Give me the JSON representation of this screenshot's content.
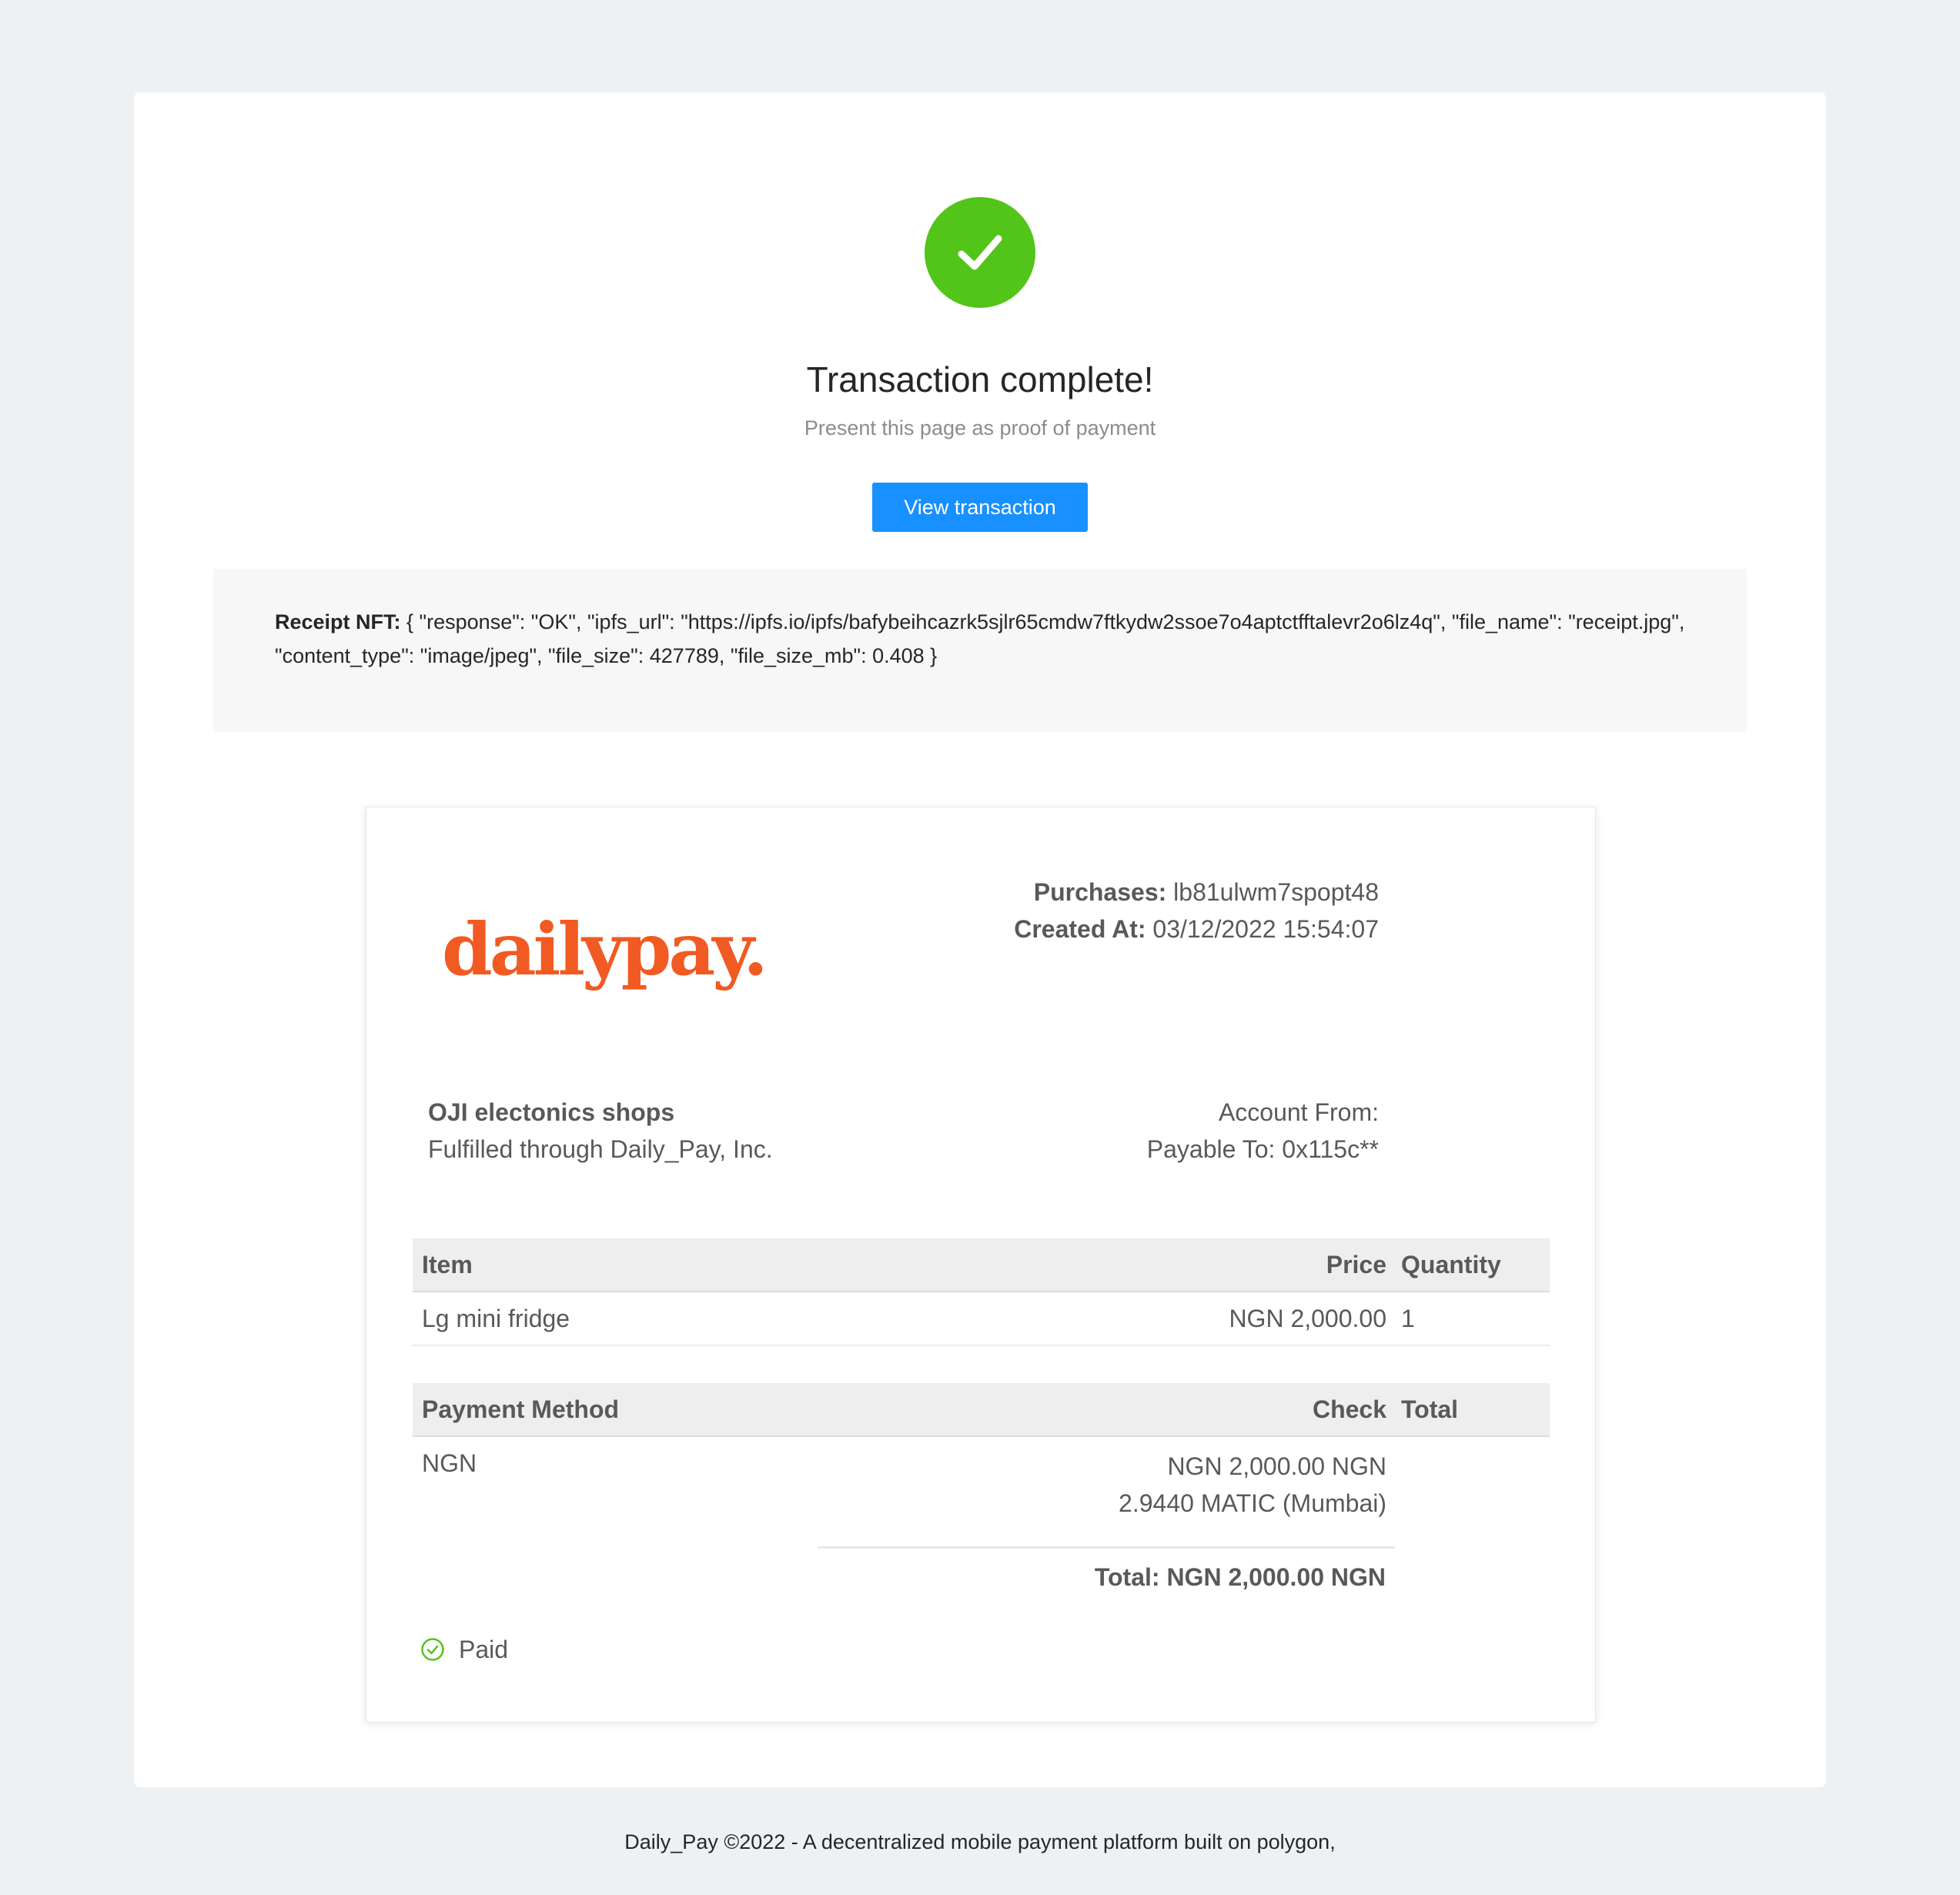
{
  "header": {
    "title": "Transaction complete!",
    "subtitle": "Present this page as proof of payment",
    "view_button_label": "View transaction",
    "icon": "check-circle-icon",
    "success_color": "#52c41a",
    "button_color": "#1890ff"
  },
  "nft": {
    "label": "Receipt NFT:",
    "value": " { \"response\": \"OK\", \"ipfs_url\": \"https://ipfs.io/ipfs/bafybeihcazrk5sjlr65cmdw7ftkydw2ssoe7o4aptctfftalevr2o6lz4q\", \"file_name\": \"receipt.jpg\", \"content_type\": \"image/jpeg\", \"file_size\": 427789, \"file_size_mb\": 0.408 }"
  },
  "receipt": {
    "logo_text": "dailypay.",
    "logo_color": "#f15a22",
    "purchases_label": "Purchases:",
    "purchases_value": " lb81ulwm7spopt48",
    "created_label": "Created At:",
    "created_value": " 03/12/2022 15:54:07",
    "merchant_name": "OJI electonics shops",
    "merchant_fulfilled": "Fulfilled through Daily_Pay, Inc.",
    "account_from": "Account From:",
    "payable_to": "Payable To: 0x115c**",
    "items_table": {
      "headers": [
        "Item",
        "Price",
        "Quantity"
      ],
      "rows": [
        {
          "item": "Lg mini fridge",
          "price": "NGN 2,000.00",
          "quantity": "1"
        }
      ]
    },
    "payment_table": {
      "headers": [
        "Payment Method",
        "Check",
        "Total"
      ],
      "rows": [
        {
          "method": "NGN",
          "check_line1": "NGN 2,000.00 NGN",
          "check_line2": "2.9440 MATIC (Mumbai)",
          "total": ""
        }
      ]
    },
    "total_text": "Total: NGN 2,000.00 NGN",
    "status": "Paid",
    "status_icon": "check-circle-outline-icon",
    "status_color": "#52c41a"
  },
  "footer": {
    "text": "Daily_Pay ©2022 - A decentralized mobile payment platform built on polygon,"
  }
}
